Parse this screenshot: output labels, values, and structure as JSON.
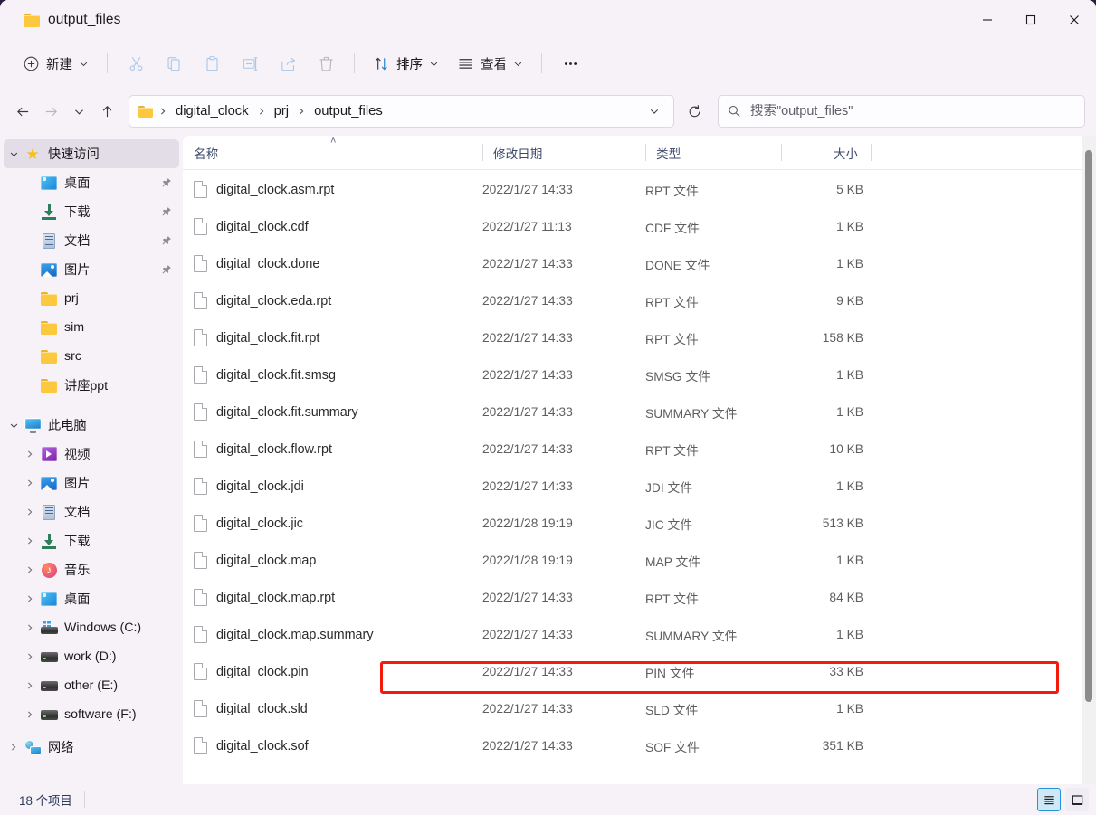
{
  "window": {
    "tab_title": "output_files",
    "minimize_label": "最小化",
    "maximize_label": "最大化",
    "close_label": "关闭"
  },
  "toolbar": {
    "new_label": "新建",
    "cut_label": "剪切",
    "copy_label": "复制",
    "paste_label": "粘贴",
    "rename_label": "重命名",
    "share_label": "共享",
    "delete_label": "删除",
    "sort_label": "排序",
    "view_label": "查看",
    "more_label": "查看更多"
  },
  "address": {
    "back_label": "返回",
    "forward_label": "前进",
    "recent_label": "最近的位置",
    "up_label": "向上",
    "refresh_label": "刷新",
    "crumbs": [
      "digital_clock",
      "prj",
      "output_files"
    ]
  },
  "search": {
    "placeholder": "搜索\"output_files\"",
    "value": ""
  },
  "sidebar": {
    "quick_access": {
      "label": "快速访问",
      "icon": "star-icon",
      "expanded": true,
      "selected": true
    },
    "quick_items": [
      {
        "label": "桌面",
        "icon": "desktop-icon",
        "pinned": true
      },
      {
        "label": "下载",
        "icon": "download-icon",
        "pinned": true
      },
      {
        "label": "文档",
        "icon": "document-icon",
        "pinned": true
      },
      {
        "label": "图片",
        "icon": "pictures-icon",
        "pinned": true
      },
      {
        "label": "prj",
        "icon": "folder-icon",
        "pinned": false
      },
      {
        "label": "sim",
        "icon": "folder-icon",
        "pinned": false
      },
      {
        "label": "src",
        "icon": "folder-icon",
        "pinned": false
      },
      {
        "label": "讲座ppt",
        "icon": "folder-icon",
        "pinned": false
      }
    ],
    "this_pc": {
      "label": "此电脑",
      "icon": "pc-icon",
      "expanded": true
    },
    "pc_items": [
      {
        "label": "视频",
        "icon": "video-icon"
      },
      {
        "label": "图片",
        "icon": "pictures-icon"
      },
      {
        "label": "文档",
        "icon": "document-icon"
      },
      {
        "label": "下载",
        "icon": "download-icon"
      },
      {
        "label": "音乐",
        "icon": "music-icon"
      },
      {
        "label": "桌面",
        "icon": "desktop-icon"
      },
      {
        "label": "Windows (C:)",
        "icon": "windows-drive-icon"
      },
      {
        "label": "work (D:)",
        "icon": "drive-icon"
      },
      {
        "label": "other (E:)",
        "icon": "drive-icon"
      },
      {
        "label": "software (F:)",
        "icon": "drive-icon"
      }
    ],
    "network": {
      "label": "网络",
      "icon": "network-icon"
    }
  },
  "columns": {
    "name": "名称",
    "date": "修改日期",
    "type": "类型",
    "size": "大小",
    "sort_caret": "˄"
  },
  "files": [
    {
      "name": "digital_clock.asm.rpt",
      "date": "2022/1/27 14:33",
      "type": "RPT 文件",
      "size": "5 KB",
      "highlighted": false
    },
    {
      "name": "digital_clock.cdf",
      "date": "2022/1/27 11:13",
      "type": "CDF 文件",
      "size": "1 KB",
      "highlighted": false
    },
    {
      "name": "digital_clock.done",
      "date": "2022/1/27 14:33",
      "type": "DONE 文件",
      "size": "1 KB",
      "highlighted": false
    },
    {
      "name": "digital_clock.eda.rpt",
      "date": "2022/1/27 14:33",
      "type": "RPT 文件",
      "size": "9 KB",
      "highlighted": false
    },
    {
      "name": "digital_clock.fit.rpt",
      "date": "2022/1/27 14:33",
      "type": "RPT 文件",
      "size": "158 KB",
      "highlighted": false
    },
    {
      "name": "digital_clock.fit.smsg",
      "date": "2022/1/27 14:33",
      "type": "SMSG 文件",
      "size": "1 KB",
      "highlighted": false
    },
    {
      "name": "digital_clock.fit.summary",
      "date": "2022/1/27 14:33",
      "type": "SUMMARY 文件",
      "size": "1 KB",
      "highlighted": false
    },
    {
      "name": "digital_clock.flow.rpt",
      "date": "2022/1/27 14:33",
      "type": "RPT 文件",
      "size": "10 KB",
      "highlighted": false
    },
    {
      "name": "digital_clock.jdi",
      "date": "2022/1/27 14:33",
      "type": "JDI 文件",
      "size": "1 KB",
      "highlighted": false
    },
    {
      "name": "digital_clock.jic",
      "date": "2022/1/28 19:19",
      "type": "JIC 文件",
      "size": "513 KB",
      "highlighted": true
    },
    {
      "name": "digital_clock.map",
      "date": "2022/1/28 19:19",
      "type": "MAP 文件",
      "size": "1 KB",
      "highlighted": false
    },
    {
      "name": "digital_clock.map.rpt",
      "date": "2022/1/27 14:33",
      "type": "RPT 文件",
      "size": "84 KB",
      "highlighted": false
    },
    {
      "name": "digital_clock.map.summary",
      "date": "2022/1/27 14:33",
      "type": "SUMMARY 文件",
      "size": "1 KB",
      "highlighted": false
    },
    {
      "name": "digital_clock.pin",
      "date": "2022/1/27 14:33",
      "type": "PIN 文件",
      "size": "33 KB",
      "highlighted": false
    },
    {
      "name": "digital_clock.sld",
      "date": "2022/1/27 14:33",
      "type": "SLD 文件",
      "size": "1 KB",
      "highlighted": false
    },
    {
      "name": "digital_clock.sof",
      "date": "2022/1/27 14:33",
      "type": "SOF 文件",
      "size": "351 KB",
      "highlighted": false
    }
  ],
  "status": {
    "item_count": "18 个项目",
    "details_view_label": "详细信息",
    "icons_view_label": "大图标"
  },
  "colors": {
    "accent": "#2196d6",
    "highlight_annotation": "#f51b0c",
    "folder_yellow": "#fcc93e",
    "window_chrome": "#f6f2f8",
    "list_background": "#ffffff"
  }
}
